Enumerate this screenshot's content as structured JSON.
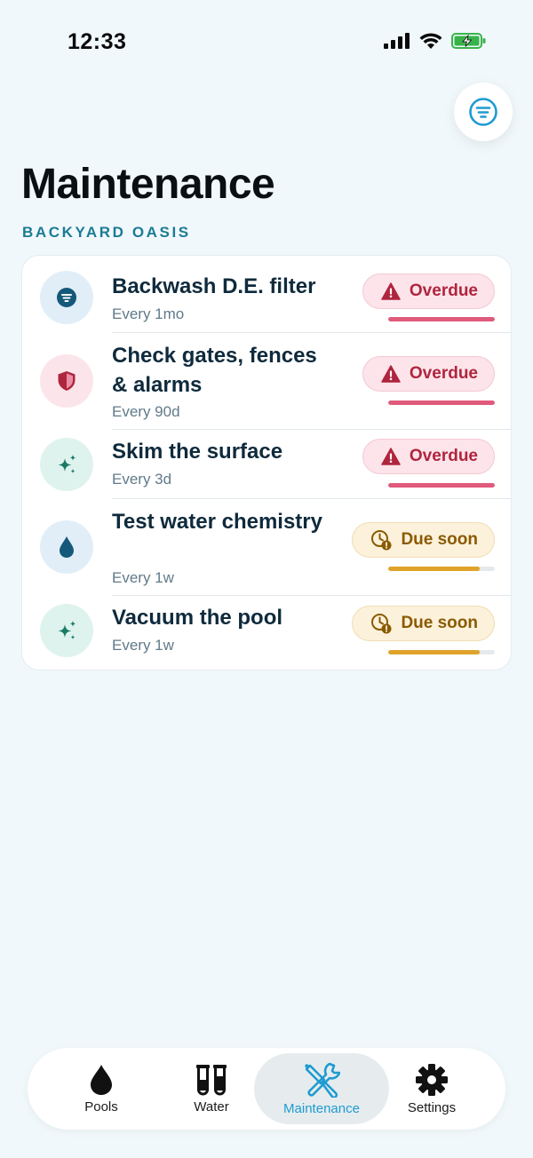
{
  "status_bar": {
    "time": "12:33"
  },
  "page": {
    "title": "Maintenance",
    "subtitle": "BACKYARD OASIS"
  },
  "tasks": [
    {
      "name": "Backwash D.E. filter",
      "frequency": "Every 1mo",
      "status": "Overdue",
      "progress": 1.0,
      "icon": "filter-icon"
    },
    {
      "name": "Check gates, fences & alarms",
      "frequency": "Every 90d",
      "status": "Overdue",
      "progress": 1.0,
      "icon": "shield-icon"
    },
    {
      "name": "Skim the surface",
      "frequency": "Every 3d",
      "status": "Overdue",
      "progress": 1.0,
      "icon": "sparkles-icon"
    },
    {
      "name": "Test water chemistry",
      "frequency": "Every 1w",
      "status": "Due soon",
      "progress": 0.86,
      "icon": "water-drop-icon"
    },
    {
      "name": "Vacuum the pool",
      "frequency": "Every 1w",
      "status": "Due soon",
      "progress": 0.86,
      "icon": "sparkles-icon"
    }
  ],
  "tabs": [
    {
      "label": "Pools",
      "icon": "drop-icon",
      "active": false
    },
    {
      "label": "Water",
      "icon": "test-tubes-icon",
      "active": false
    },
    {
      "label": "Maintenance",
      "icon": "tools-icon",
      "active": true
    },
    {
      "label": "Settings",
      "icon": "gear-icon",
      "active": false
    }
  ],
  "colors": {
    "accent": "#1e9bd2",
    "overdue": "#e05a7b",
    "due_soon": "#e0a32a",
    "background": "#f1f8fb"
  }
}
